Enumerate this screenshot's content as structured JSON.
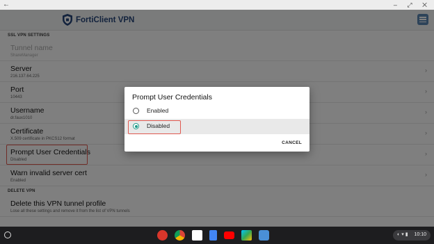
{
  "window": {
    "back_glyph": "←",
    "controls": "– ⤢ ✕"
  },
  "app": {
    "title": "FortiClient VPN",
    "logo_icon": "forticlient-shield-icon",
    "menu_icon": "hamburger-menu-icon"
  },
  "settings": {
    "ssl_section_header": "SSL VPN SETTINGS",
    "delete_section_header": "DELETE VPN",
    "rows": [
      {
        "title": "Tunnel name",
        "value": "ShareManager",
        "disabled": true
      },
      {
        "title": "Server",
        "value": "216.137.64.225"
      },
      {
        "title": "Port",
        "value": "10443"
      },
      {
        "title": "Username",
        "value": "dr.faux1010"
      },
      {
        "title": "Certificate",
        "value": "X.509 certificate in PKCS12 format"
      },
      {
        "title": "Prompt User Credentials",
        "value": "Disabled"
      },
      {
        "title": "Warn invalid server cert",
        "value": "Enabled"
      }
    ],
    "delete_row": {
      "title": "Delete this VPN tunnel profile",
      "value": "Lose all these settings and remove it from the list of VPN tunnels"
    }
  },
  "dialog": {
    "title": "Prompt User Credentials",
    "options": [
      "Enabled",
      "Disabled"
    ],
    "selected": "Disabled",
    "cancel_label": "CANCEL"
  },
  "shelf": {
    "apps": [
      "forticlient-icon",
      "chrome-icon",
      "gmail-icon",
      "docs-icon",
      "youtube-icon",
      "play-store-icon",
      "forticlient-vpn-icon"
    ],
    "time": "10:10"
  },
  "colors": {
    "brand": "#27467a",
    "accent": "#1e9a8a",
    "highlight": "#e0584f"
  }
}
